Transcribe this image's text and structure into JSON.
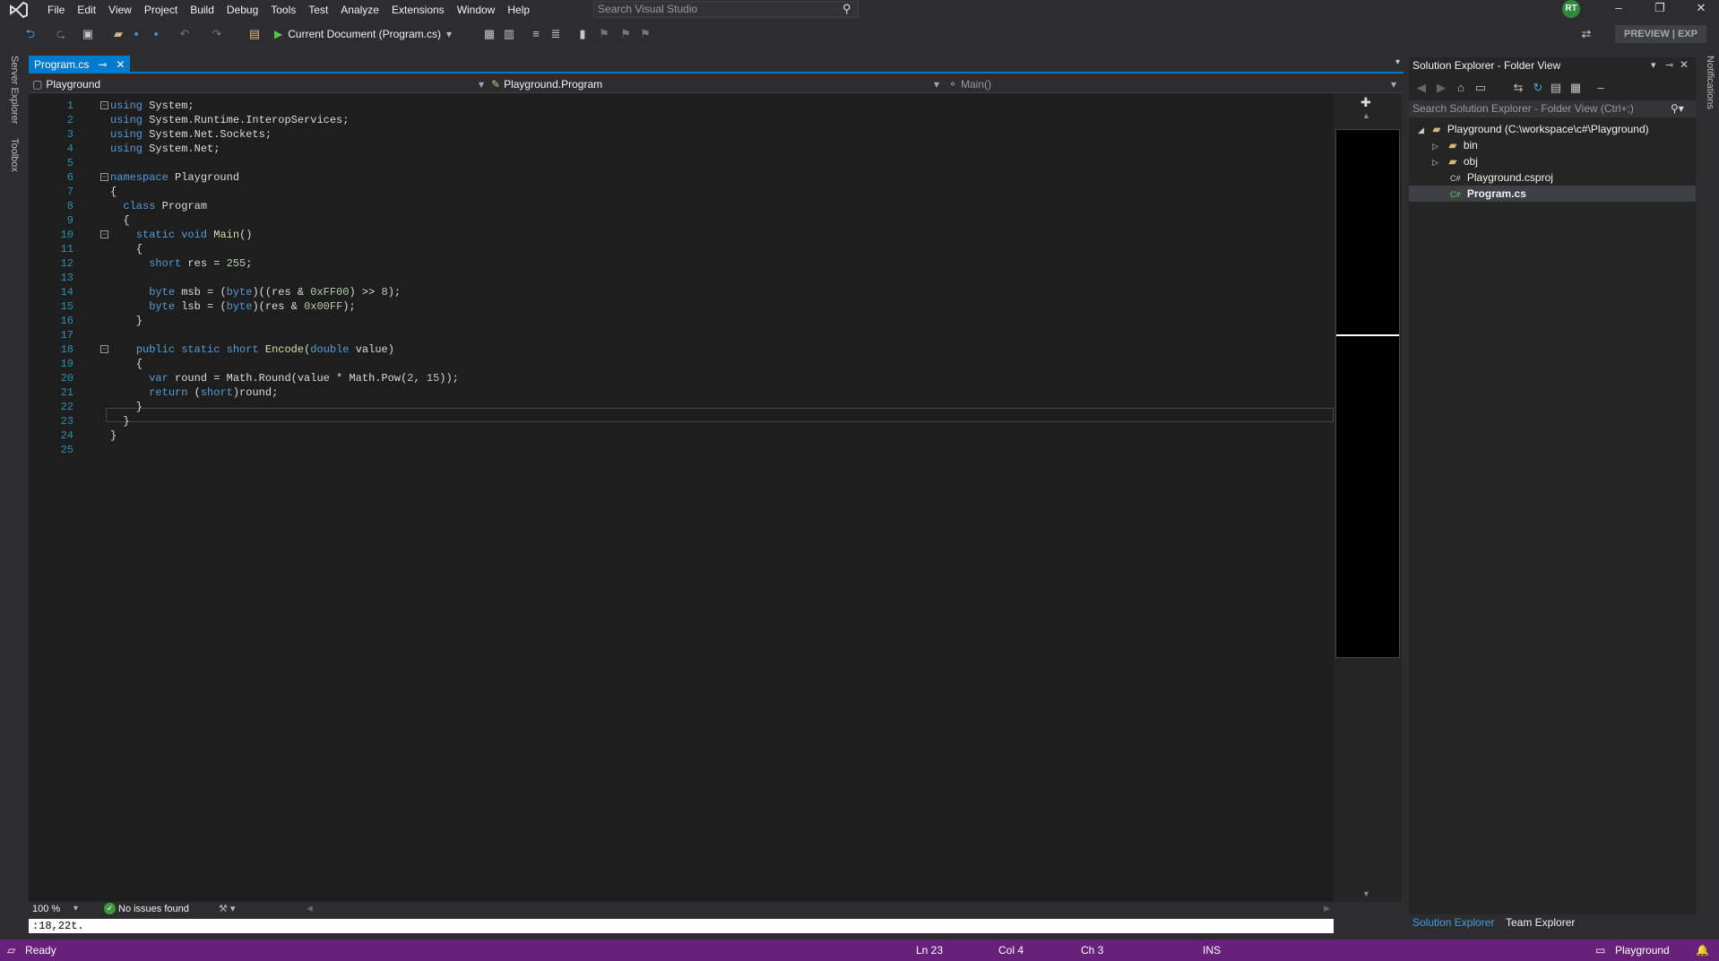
{
  "menu": [
    "File",
    "Edit",
    "View",
    "Project",
    "Build",
    "Debug",
    "Tools",
    "Test",
    "Analyze",
    "Extensions",
    "Window",
    "Help"
  ],
  "search": {
    "placeholder": "Search Visual Studio"
  },
  "user": {
    "initials": "RT"
  },
  "toolbar": {
    "run_label": "Current Document (Program.cs)",
    "preview_label": "PREVIEW | EXP"
  },
  "left_strip": {
    "server_explorer": "Server Explorer",
    "toolbox": "Toolbox"
  },
  "tabs": [
    {
      "label": "Program.cs"
    }
  ],
  "navbar": {
    "project": "Playground",
    "class": "Playground.Program",
    "member": "Main()"
  },
  "editor": {
    "lines": [
      "using System;",
      "using System.Runtime.InteropServices;",
      "using System.Net.Sockets;",
      "using System.Net;",
      "",
      "namespace Playground",
      "{",
      "  class Program",
      "  {",
      "    static void Main()",
      "    {",
      "      short res = 255;",
      "",
      "      byte msb = (byte)((res & 0xFF00) >> 8);",
      "      byte lsb = (byte)(res & 0x00FF);",
      "    }",
      "",
      "    public static short Encode(double value)",
      "    {",
      "      var round = Math.Round(value * Math.Pow(2, 15));",
      "      return (short)round;",
      "    }",
      "  }",
      "}",
      ""
    ],
    "line_numbers": [
      "1",
      "2",
      "3",
      "4",
      "5",
      "6",
      "7",
      "8",
      "9",
      "10",
      "11",
      "12",
      "13",
      "14",
      "15",
      "16",
      "17",
      "18",
      "19",
      "20",
      "21",
      "22",
      "23",
      "24",
      "25"
    ]
  },
  "editor_bottom": {
    "zoom": "100 %",
    "issues": "No issues found"
  },
  "command_input": ":18,22t.",
  "solution_explorer": {
    "title": "Solution Explorer - Folder View",
    "search_placeholder": "Search Solution Explorer - Folder View (Ctrl+;)",
    "root": "Playground (C:\\workspace\\c#\\Playground)",
    "items": [
      "bin",
      "obj",
      "Playground.csproj",
      "Program.cs"
    ],
    "tabs": [
      "Solution Explorer",
      "Team Explorer"
    ]
  },
  "notifications_label": "Notifications",
  "status": {
    "ready": "Ready",
    "ln": "Ln 23",
    "col": "Col 4",
    "ch": "Ch 3",
    "ins": "INS",
    "project": "Playground"
  },
  "colors": {
    "accent": "#007acc",
    "status_bar": "#68217a",
    "editor_bg": "#1e1e1e"
  }
}
